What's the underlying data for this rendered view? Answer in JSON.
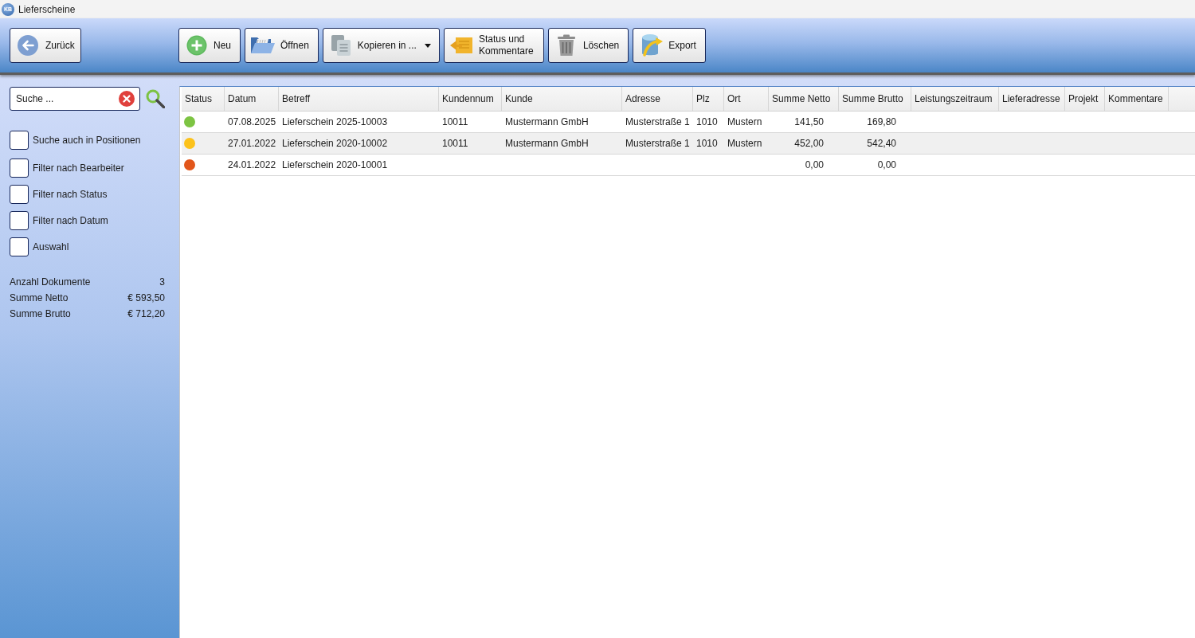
{
  "window": {
    "logo": "KB",
    "title": "Lieferscheine"
  },
  "toolbar": {
    "back_button": {
      "label": "Zurück"
    },
    "buttons": [
      {
        "kind": "new",
        "label": "Neu",
        "dropdown": false
      },
      {
        "kind": "open",
        "label": "Öffnen",
        "dropdown": false
      },
      {
        "kind": "copy",
        "label": "Kopieren in ...",
        "dropdown": true
      },
      {
        "kind": "status",
        "label": "Status und Kommentare",
        "dropdown": false
      },
      {
        "kind": "delete",
        "label": "Löschen",
        "dropdown": false
      },
      {
        "kind": "export",
        "label": "Export",
        "dropdown": false
      }
    ]
  },
  "sidebar": {
    "search": {
      "placeholder": "Suche ..."
    },
    "filters": [
      {
        "label": "Suche auch in Positionen",
        "checked": false
      },
      {
        "label": "Filter nach Bearbeiter",
        "checked": false
      },
      {
        "label": "Filter nach Status",
        "checked": false
      },
      {
        "label": "Filter nach Datum",
        "checked": false
      },
      {
        "label": "Auswahl",
        "checked": false
      }
    ],
    "summary": [
      {
        "label": "Anzahl Dokumente",
        "value": "3"
      },
      {
        "label": "Summe Netto",
        "value": "€ 593,50"
      },
      {
        "label": "Summe Brutto",
        "value": "€ 712,20"
      }
    ]
  },
  "table": {
    "columns": [
      "Status",
      "Datum",
      "Betreff",
      "Kundennum",
      "Kunde",
      "Adresse",
      "Plz",
      "Ort",
      "Summe Netto",
      "Summe Brutto",
      "Leistungszeitraum",
      "Lieferadresse",
      "Projekt",
      "Kommentare"
    ],
    "rows": [
      {
        "color": "#7dc443",
        "date": "07.08.2025",
        "subject": "Lieferschein 2025-10003",
        "column_4": "10011",
        "customer": "Mustermann GmbH",
        "address": "Musterstraße 1",
        "zip": "1010",
        "city": "Mustern",
        "net": "141,50",
        "gross": "169,80"
      },
      {
        "color": "#fcc21b",
        "date": "27.01.2022",
        "subject": "Lieferschein 2020-10002",
        "column_4": "10011",
        "customer": "Mustermann GmbH",
        "address": "Musterstraße 1",
        "zip": "1010",
        "city": "Mustern",
        "net": "452,00",
        "gross": "542,40"
      },
      {
        "color": "#e2561b",
        "date": "24.01.2022",
        "subject": "Lieferschein 2020-10001",
        "net": "0,00",
        "gross": "0,00"
      }
    ]
  }
}
